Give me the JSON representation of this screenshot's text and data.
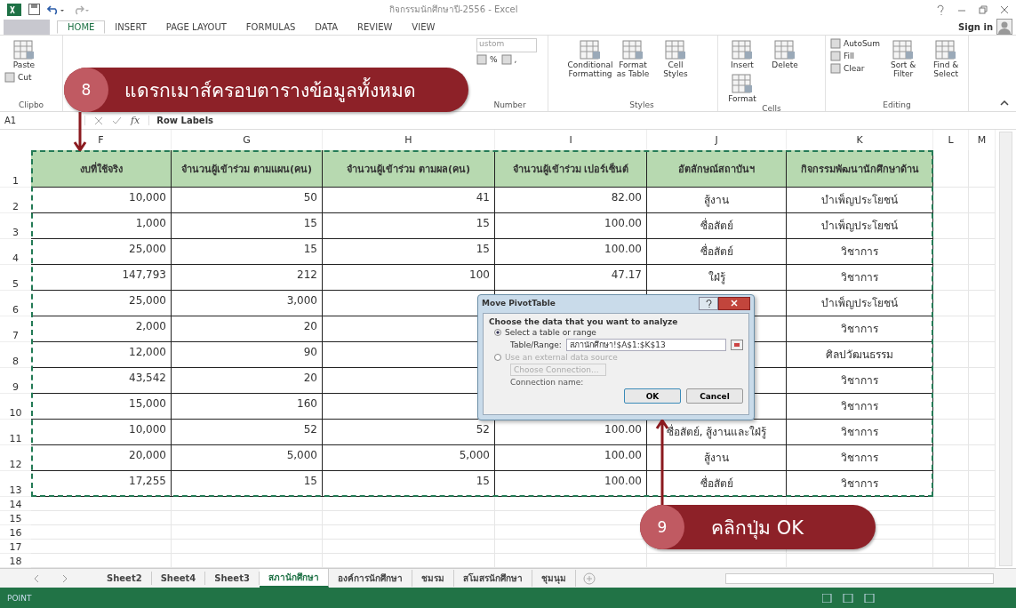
{
  "window": {
    "title": "กิจกรรมนักศึกษาปี-2556 - Excel",
    "sign_in": "Sign in"
  },
  "ribbon_tabs": [
    {
      "label": "HOME",
      "selected": true
    },
    {
      "label": "INSERT",
      "selected": false
    },
    {
      "label": "PAGE LAYOUT",
      "selected": false
    },
    {
      "label": "FORMULAS",
      "selected": false
    },
    {
      "label": "DATA",
      "selected": false
    },
    {
      "label": "REVIEW",
      "selected": false
    },
    {
      "label": "VIEW",
      "selected": false
    }
  ],
  "ribbon_groups": [
    {
      "label": "Clipbo",
      "items": [
        {
          "label": "Paste",
          "kind": "large"
        },
        {
          "label": "Cut",
          "kind": "small"
        }
      ]
    },
    {
      "label": "Number",
      "items": [
        {
          "label": "ustom",
          "kind": "dropdown"
        },
        {
          "label": "%",
          "kind": "small"
        },
        {
          "label": ",",
          "kind": "small"
        }
      ]
    },
    {
      "label": "Styles",
      "items": [
        {
          "label": "Conditional Formatting",
          "kind": "large"
        },
        {
          "label": "Format as Table",
          "kind": "large"
        },
        {
          "label": "Cell Styles",
          "kind": "large"
        }
      ]
    },
    {
      "label": "Cells",
      "items": [
        {
          "label": "Insert",
          "kind": "large"
        },
        {
          "label": "Delete",
          "kind": "large"
        },
        {
          "label": "Format",
          "kind": "large"
        }
      ]
    },
    {
      "label": "Editing",
      "items": [
        {
          "label": "AutoSum",
          "kind": "small"
        },
        {
          "label": "Fill",
          "kind": "small"
        },
        {
          "label": "Clear",
          "kind": "small"
        },
        {
          "label": "Sort & Filter",
          "kind": "large"
        },
        {
          "label": "Find & Select",
          "kind": "large"
        }
      ]
    }
  ],
  "formula_bar": {
    "name_box": "A1",
    "fx": "fx",
    "formula": "Row Labels"
  },
  "columns": [
    "F",
    "G",
    "H",
    "I",
    "J",
    "K",
    "L",
    "M"
  ],
  "row_numbers": [
    "1",
    "2",
    "3",
    "4",
    "5",
    "6",
    "7",
    "8",
    "9",
    "10",
    "11",
    "12",
    "13",
    "14",
    "15",
    "16",
    "17",
    "18"
  ],
  "table": {
    "header": [
      "งบที่ใช้จริง",
      "จำนวนผู้เข้าร่วม ตามแผน(คน)",
      "จำนวนผู้เข้าร่วม ตามผล(คน)",
      "จำนวนผู้เข้าร่วม เปอร์เซ็นต์",
      "อัตลักษณ์สถาบันฯ",
      "กิจกรรมพัฒนานักศึกษาด้าน"
    ],
    "rows": [
      [
        "10,000",
        "50",
        "41",
        "82.00",
        "สู้งาน",
        "บำเพ็ญประโยชน์"
      ],
      [
        "1,000",
        "15",
        "15",
        "100.00",
        "ซื่อสัตย์",
        "บำเพ็ญประโยชน์"
      ],
      [
        "25,000",
        "15",
        "15",
        "100.00",
        "ซื่อสัตย์",
        "วิชาการ"
      ],
      [
        "147,793",
        "212",
        "100",
        "47.17",
        "ใฝ่รู้",
        "วิชาการ"
      ],
      [
        "25,000",
        "3,000",
        null,
        null,
        null,
        "บำเพ็ญประโยชน์"
      ],
      [
        "2,000",
        "20",
        null,
        null,
        null,
        "วิชาการ"
      ],
      [
        "12,000",
        "90",
        null,
        null,
        null,
        "ศิลปวัฒนธรรม"
      ],
      [
        "43,542",
        "20",
        null,
        null,
        null,
        "วิชาการ"
      ],
      [
        "15,000",
        "160",
        null,
        null,
        null,
        "วิชาการ"
      ],
      [
        "10,000",
        "52",
        "52",
        "100.00",
        "ซื่อสัตย์, สู้งานและใฝ่รู้",
        "วิชาการ"
      ],
      [
        "20,000",
        "5,000",
        "5,000",
        "100.00",
        "สู้งาน",
        "วิชาการ"
      ],
      [
        "17,255",
        "15",
        "15",
        "100.00",
        "ซื่อสัตย์",
        "วิชาการ"
      ]
    ]
  },
  "dialog": {
    "title": "Move PivotTable",
    "prompt": "Choose the data that you want to analyze",
    "options": [
      {
        "label": "Select a table or range",
        "selected": true
      },
      {
        "label": "Use an external data source",
        "selected": false
      }
    ],
    "range_label": "Table/Range:",
    "range_value": "สภานักศึกษา!$A$1:$K$13",
    "choose_connection": {
      "label": "Choose Connection...",
      "disabled": true
    },
    "connection_label": "Connection name:",
    "buttons": [
      "OK",
      "Cancel"
    ]
  },
  "callouts": [
    {
      "number": "8",
      "text": "แดรกเมาส์ครอบตารางข้อมูลทั้งหมด"
    },
    {
      "number": "9",
      "text": "คลิกปุ่ม OK"
    }
  ],
  "sheet_tabs": [
    {
      "label": "Sheet2",
      "selected": false
    },
    {
      "label": "Sheet4",
      "selected": false
    },
    {
      "label": "Sheet3",
      "selected": false
    },
    {
      "label": "สภานักศึกษา",
      "selected": true
    },
    {
      "label": "องค์การนักศึกษา",
      "selected": false
    },
    {
      "label": "ชมรม",
      "selected": false
    },
    {
      "label": "สโมสรนักศึกษา",
      "selected": false
    },
    {
      "label": "ชุมนุม",
      "selected": false
    }
  ],
  "status_bar": {
    "mode": "POINT"
  }
}
